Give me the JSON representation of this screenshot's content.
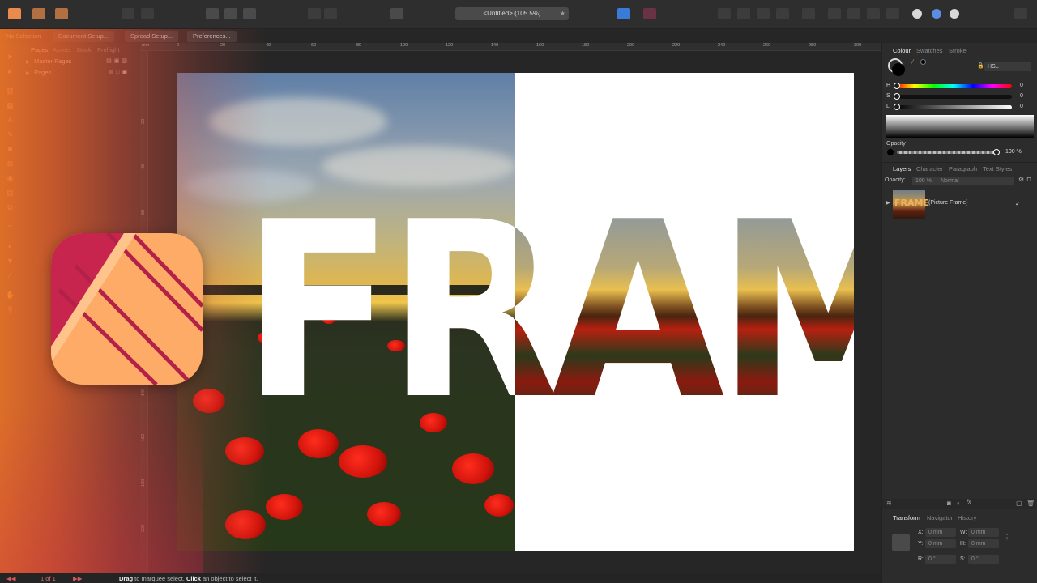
{
  "toolbar": {
    "document_title": "<Untitled> (105.5%)"
  },
  "context_bar": {
    "selection": "No Selection",
    "document_setup": "Document Setup...",
    "spread_setup": "Spread Setup...",
    "preferences": "Preferences..."
  },
  "pages_panel": {
    "tabs": [
      "Pages",
      "Assets",
      "Stock",
      "Preflight"
    ],
    "rows": [
      "Master Pages",
      "Pages"
    ]
  },
  "ruler": {
    "top": [
      "mm",
      "0",
      "20",
      "40",
      "60",
      "80",
      "100",
      "120",
      "140",
      "160",
      "180",
      "200",
      "220",
      "240",
      "260",
      "280",
      "300"
    ],
    "left": [
      "20",
      "40",
      "60",
      "80",
      "100",
      "120",
      "140",
      "160",
      "180",
      "200"
    ]
  },
  "canvas": {
    "headline": "FRAME"
  },
  "colour_panel": {
    "tabs": [
      "Colour",
      "Swatches",
      "Stroke"
    ],
    "model": "HSL",
    "h_label": "H",
    "h_value": "0",
    "s_label": "S",
    "s_value": "0",
    "l_label": "L",
    "l_value": "0",
    "opacity_label": "Opacity",
    "opacity_value": "100 %"
  },
  "layers_panel": {
    "tabs": [
      "Layers",
      "Character",
      "Paragraph",
      "Text Styles"
    ],
    "opacity_label": "Opacity:",
    "opacity_value": "100 %",
    "blend_mode": "Normal",
    "layer_name": "(Picture Frame)",
    "thumb_text": "FRAME"
  },
  "transform_panel": {
    "tabs": [
      "Transform",
      "Navigator",
      "History"
    ],
    "x_label": "X:",
    "x_value": "0 mm",
    "y_label": "Y:",
    "y_value": "0 mm",
    "w_label": "W:",
    "w_value": "0 mm",
    "h_label": "H:",
    "h_value": "0 mm",
    "r_label": "R:",
    "r_value": "0 °",
    "s_label": "S:",
    "s_value": "0 °"
  },
  "status_bar": {
    "page": "1 of 1",
    "hint_drag": "Drag",
    "hint_mid": " to marquee select. ",
    "hint_click": "Click",
    "hint_end": " an object to select it."
  },
  "colors": {
    "accent_orange": "#f4822f",
    "logo_peach": "#fdab66",
    "logo_crimson": "#c7254e",
    "selection_blue": "#3a7ad9"
  }
}
